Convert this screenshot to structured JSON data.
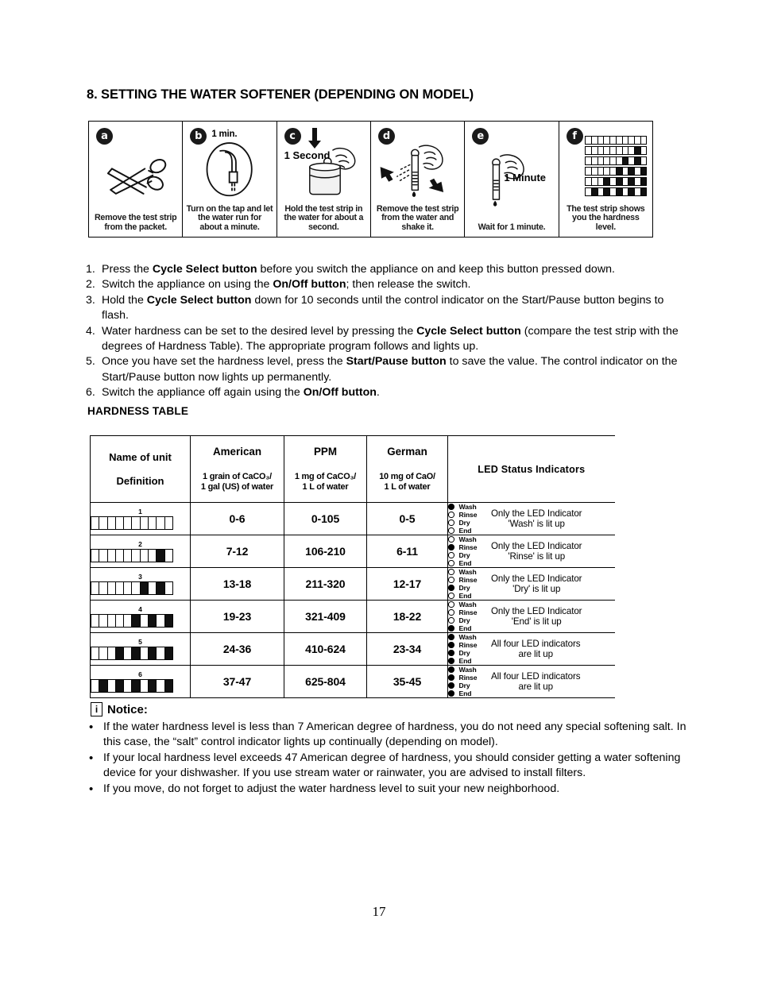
{
  "section": {
    "heading": "8. SETTING THE WATER SOFTENER (DEPENDING ON MODEL)"
  },
  "illustration": {
    "panels": [
      {
        "badge": "a",
        "note": "",
        "caption": "Remove the test strip from the packet.",
        "icon": "scissors-icon"
      },
      {
        "badge": "b",
        "note": "1 min.",
        "caption": "Turn on the tap and let the water run for about a minute.",
        "icon": "tap-water-icon"
      },
      {
        "badge": "c",
        "note": "",
        "inline_label": "1 Second",
        "caption": "Hold the test strip in the water for about a second.",
        "icon": "hand-strip-beaker-icon"
      },
      {
        "badge": "d",
        "note": "",
        "caption": "Remove the test strip from the water and shake it.",
        "icon": "shake-strip-icon"
      },
      {
        "badge": "e",
        "note": "",
        "inline_label": "1 Minute",
        "caption": "Wait for 1 minute.",
        "icon": "wait-strip-icon"
      },
      {
        "badge": "f",
        "note": "",
        "caption": "The test strip shows you the hardness level.",
        "icon": "test-strip-chart-icon"
      }
    ]
  },
  "steps": [
    {
      "num": "1.",
      "parts": [
        {
          "t": "Press the ",
          "b": false
        },
        {
          "t": "Cycle Select button",
          "b": true
        },
        {
          "t": " before you switch the appliance on and keep this button pressed down.",
          "b": false
        }
      ]
    },
    {
      "num": "2.",
      "parts": [
        {
          "t": "Switch the appliance on using the ",
          "b": false
        },
        {
          "t": "On/Off button",
          "b": true
        },
        {
          "t": "; then release the switch.",
          "b": false
        }
      ]
    },
    {
      "num": "3.",
      "parts": [
        {
          "t": "Hold the ",
          "b": false
        },
        {
          "t": "Cycle Select button",
          "b": true
        },
        {
          "t": " down for 10 seconds until the control indicator on the Start/Pause button begins to flash.",
          "b": false
        }
      ]
    },
    {
      "num": "4.",
      "parts": [
        {
          "t": "Water hardness can be set to the desired level by pressing the ",
          "b": false
        },
        {
          "t": "Cycle Select button",
          "b": true
        },
        {
          "t": " (compare the test strip with the degrees of Hardness Table). The appropriate program follows and lights up.",
          "b": false
        }
      ]
    },
    {
      "num": "5.",
      "parts": [
        {
          "t": "Once you have set the hardness level, press the ",
          "b": false
        },
        {
          "t": "Start/Pause button",
          "b": true
        },
        {
          "t": " to save the value. The control indicator on the Start/Pause button now lights up permanently.",
          "b": false
        }
      ]
    },
    {
      "num": "6.",
      "parts": [
        {
          "t": "Switch the appliance off again using the ",
          "b": false
        },
        {
          "t": "On/Off button",
          "b": true
        },
        {
          "t": ".",
          "b": false
        }
      ]
    }
  ],
  "hardness_table": {
    "title": "HARDNESS TABLE",
    "header": {
      "name_of_unit": "Name of unit",
      "definition": "Definition",
      "columns": [
        {
          "unit": "American",
          "definition": "1 grain of CaCO₃/\n1 gal (US) of water"
        },
        {
          "unit": "PPM",
          "definition": "1 mg of CaCO₃/\n1 L of water"
        },
        {
          "unit": "German",
          "definition": "10 mg of CaO/\n1 L of water"
        }
      ],
      "led": "LED Status Indicators"
    },
    "rows": [
      {
        "no": "1",
        "strip": [
          0,
          0,
          0,
          0,
          0,
          0,
          0,
          0,
          0,
          0
        ],
        "american": "0-6",
        "ppm": "0-105",
        "german": "0-5",
        "leds": [
          1,
          0,
          0,
          0
        ],
        "led_names": [
          "Wash",
          "Rinse",
          "Dry",
          "End"
        ],
        "desc": "Only the LED Indicator\n'Wash' is lit up"
      },
      {
        "no": "2",
        "strip": [
          0,
          0,
          0,
          0,
          0,
          0,
          0,
          0,
          1,
          0
        ],
        "american": "7-12",
        "ppm": "106-210",
        "german": "6-11",
        "leds": [
          0,
          1,
          0,
          0
        ],
        "led_names": [
          "Wash",
          "Rinse",
          "Dry",
          "End"
        ],
        "desc": "Only the LED Indicator\n'Rinse' is lit up"
      },
      {
        "no": "3",
        "strip": [
          0,
          0,
          0,
          0,
          0,
          0,
          1,
          0,
          1,
          0
        ],
        "american": "13-18",
        "ppm": "211-320",
        "german": "12-17",
        "leds": [
          0,
          0,
          1,
          0
        ],
        "led_names": [
          "Wash",
          "Rinse",
          "Dry",
          "End"
        ],
        "desc": "Only the LED Indicator\n'Dry' is lit up"
      },
      {
        "no": "4",
        "strip": [
          0,
          0,
          0,
          0,
          0,
          1,
          0,
          1,
          0,
          1
        ],
        "american": "19-23",
        "ppm": "321-409",
        "german": "18-22",
        "leds": [
          0,
          0,
          0,
          1
        ],
        "led_names": [
          "Wash",
          "Rinse",
          "Dry",
          "End"
        ],
        "desc": "Only the LED Indicator\n'End' is lit up"
      },
      {
        "no": "5",
        "strip": [
          0,
          0,
          0,
          1,
          0,
          1,
          0,
          1,
          0,
          1
        ],
        "american": "24-36",
        "ppm": "410-624",
        "german": "23-34",
        "leds": [
          1,
          1,
          1,
          1
        ],
        "led_names": [
          "Wash",
          "Rinse",
          "Dry",
          "End"
        ],
        "desc": "All four LED indicators\nare lit up"
      },
      {
        "no": "6",
        "strip": [
          0,
          1,
          0,
          1,
          0,
          1,
          0,
          1,
          0,
          1
        ],
        "american": "37-47",
        "ppm": "625-804",
        "german": "35-45",
        "leds": [
          1,
          1,
          1,
          1
        ],
        "led_names": [
          "Wash",
          "Rinse",
          "Dry",
          "End"
        ],
        "desc": "All four LED indicators\nare lit up"
      }
    ]
  },
  "notice": {
    "icon_letter": "i",
    "title": "Notice:",
    "bullet": "•",
    "items": [
      "If the water hardness level is less than 7 American degree of hardness, you do not need any special softening salt. In this case, the “salt” control indicator lights up continually (depending on model).",
      "If your local hardness level exceeds 47 American degree of hardness, you should consider getting a water softening device for your dishwasher. If you use stream water or rainwater, you are advised to install filters.",
      "If you move, do not forget to adjust the water hardness level to suit your new neighborhood."
    ]
  },
  "footer": {
    "page_number": "17"
  },
  "colors": {
    "ink": "#000000",
    "paper": "#ffffff"
  }
}
